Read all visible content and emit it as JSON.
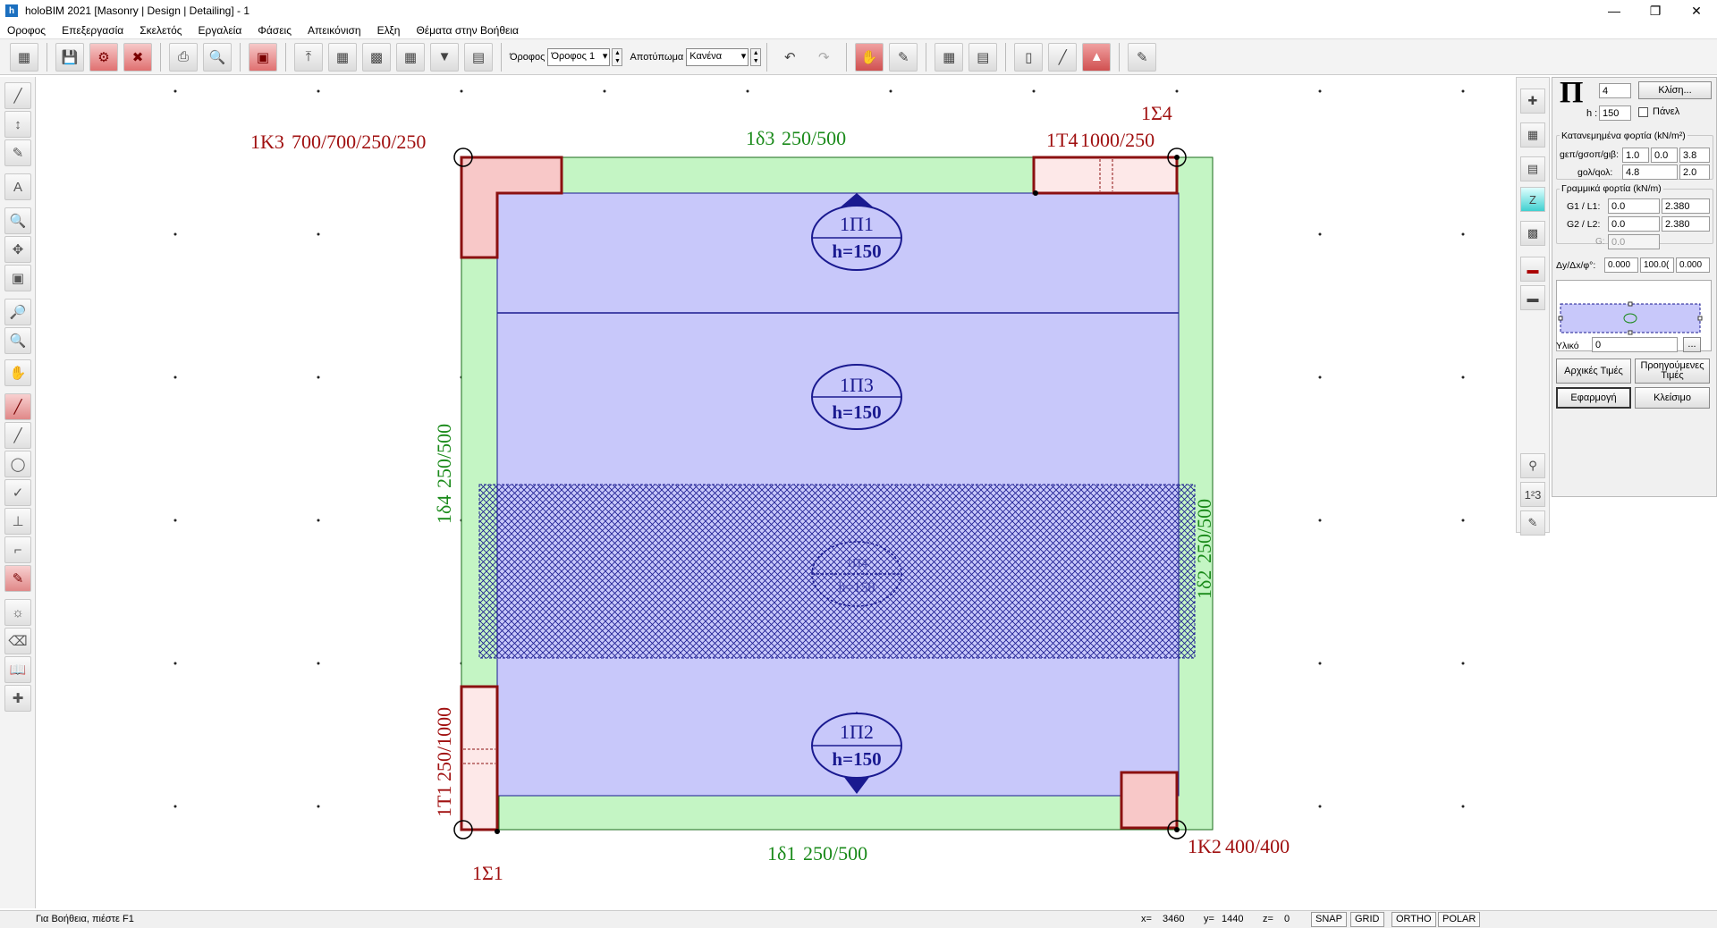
{
  "window": {
    "title": "holoBIM 2021 [Masonry | Design | Detailing] - 1",
    "app_icon": "h"
  },
  "menu": [
    "Οροφος",
    "Επεξεργασία",
    "Σκελετός",
    "Εργαλεία",
    "Φάσεις",
    "Απεικόνιση",
    "Ελξη",
    "Θέματα στην Βοήθεια"
  ],
  "toolbar": {
    "floor_label": "Όροφος",
    "floor_value": "Όροφος 1",
    "imprint_label": "Αποτύπωμα",
    "imprint_value": "Κανένα"
  },
  "drawing": {
    "columns": [
      {
        "id": "1Κ3",
        "label": "700/700/250/250"
      },
      {
        "id": "1Τ4",
        "label": "1000/250"
      },
      {
        "id": "1Τ1",
        "label": "250/1000"
      },
      {
        "id": "1Κ2",
        "label": "400/400"
      }
    ],
    "beams": [
      {
        "id": "1δ3",
        "label": "250/500"
      },
      {
        "id": "1δ2",
        "label": "250/500"
      },
      {
        "id": "1δ4",
        "label": "250/500"
      },
      {
        "id": "1δ1",
        "label": "250/500"
      }
    ],
    "slabs": [
      {
        "id": "1Π1",
        "h": "h=150"
      },
      {
        "id": "1Π3",
        "h": "h=150"
      },
      {
        "id": "1Π4",
        "h": "h=150"
      },
      {
        "id": "1Π2",
        "h": "h=150"
      }
    ],
    "nodes": [
      "1Σ4",
      "1Σ1"
    ],
    "colors": {
      "column_fill": "#f8c8c8",
      "column_stroke": "#8b1010",
      "beam_fill": "#c4f5c4",
      "slab_fill": "#c8c8fa",
      "slab_stroke": "#1a1a90",
      "green_text": "#1a8a1a",
      "red_text": "#a01010"
    }
  },
  "panel": {
    "type_symbol": "Π",
    "number_value": "4",
    "locked_button": "Κλίση...",
    "h_label": "h :",
    "h_value": "150",
    "panel_checkbox": "Πάνελ",
    "distributed_title": "Κατανεμημένα φορτία (kN/m²)",
    "row1_label": "gεπ/gσοπ/gιβ:",
    "row1_values": [
      "1.0",
      "0.0",
      "3.8"
    ],
    "row2_label": "gολ/qολ:",
    "row2_values": [
      "4.8",
      "2.0"
    ],
    "linear_title": "Γραμμικά φορτία (kN/m)",
    "g1_label": "G1 / L1:",
    "g1_values": [
      "0.0",
      "2.380"
    ],
    "g2_label": "G2 / L2:",
    "g2_values": [
      "0.0",
      "2.380"
    ],
    "g_label": "G:",
    "g_value": "0.0",
    "dxy_label": "Δy/Δx/φ°:",
    "dxy_values": [
      "0.000",
      "100.0(",
      "0.000"
    ],
    "material_label": "Υλικό",
    "material_value": "0",
    "material_btn": "...",
    "btn_initial": "Αρχικές Τιμές",
    "btn_previous": "Προηγούμενες Τιμές",
    "btn_apply": "Εφαρμογή",
    "btn_close": "Κλείσιμο",
    "right_strip_123": "1²3"
  },
  "status": {
    "help": "Για Βοήθεια, πιέστε F1",
    "x_label": "x=",
    "x_value": "3460",
    "y_label": "y=",
    "y_value": "1440",
    "z_label": "z=",
    "z_value": "0",
    "toggles": [
      "SNAP",
      "GRID",
      "ORTHO",
      "POLAR"
    ]
  }
}
